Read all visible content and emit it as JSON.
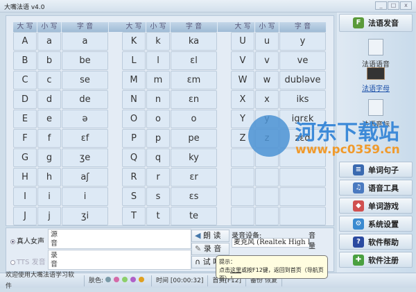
{
  "window": {
    "title": "大嘴法语 v4.0",
    "min": "_",
    "max": "□",
    "close": "x"
  },
  "table": {
    "headers": [
      "大 写",
      "小 写",
      "字 音"
    ],
    "groups": [
      [
        [
          "A",
          "a",
          "a"
        ],
        [
          "B",
          "b",
          "be"
        ],
        [
          "C",
          "c",
          "se"
        ],
        [
          "D",
          "d",
          "de"
        ],
        [
          "E",
          "e",
          "ə"
        ],
        [
          "F",
          "f",
          "ɛf"
        ],
        [
          "G",
          "g",
          "ʒe"
        ],
        [
          "H",
          "h",
          "aʃ"
        ],
        [
          "I",
          "i",
          "i"
        ],
        [
          "J",
          "j",
          "ʒi"
        ]
      ],
      [
        [
          "K",
          "k",
          "ka"
        ],
        [
          "L",
          "l",
          "ɛl"
        ],
        [
          "M",
          "m",
          "ɛm"
        ],
        [
          "N",
          "n",
          "ɛn"
        ],
        [
          "O",
          "o",
          "o"
        ],
        [
          "P",
          "p",
          "pe"
        ],
        [
          "Q",
          "q",
          "ky"
        ],
        [
          "R",
          "r",
          "ɛr"
        ],
        [
          "S",
          "s",
          "ɛs"
        ],
        [
          "T",
          "t",
          "te"
        ]
      ],
      [
        [
          "U",
          "u",
          "y"
        ],
        [
          "V",
          "v",
          "ve"
        ],
        [
          "W",
          "w",
          "dubləve"
        ],
        [
          "X",
          "x",
          "iks"
        ],
        [
          "Y",
          "y",
          "igrɛk"
        ],
        [
          "Z",
          "z",
          "zɛd"
        ],
        [
          "",
          "",
          ""
        ],
        [
          "",
          "",
          ""
        ],
        [
          "",
          "",
          ""
        ],
        [
          "",
          "",
          ""
        ]
      ]
    ]
  },
  "bottom": {
    "voice_real": "真人女声",
    "voice_tts": "TTS 发音",
    "source_label": "源音",
    "record_label": "录音",
    "read_btn": "朗 读",
    "record_btn": "录 音",
    "listen_btn": "试 听",
    "device_label": "录音设备:",
    "device_value": "麦克风 (Realtek High I",
    "volume_label": "音 量"
  },
  "tooltip": {
    "title": "提示：",
    "pre": "点击",
    "link": "这里",
    "post": "或按F12键，返回到首页（导航页面）！"
  },
  "status": {
    "welcome": "欢迎使用大嘴法语学习软件",
    "skin_label": "肤色:",
    "skins": [
      "#7a9aa8",
      "#d46aa8",
      "#8ccf6a",
      "#b060c8",
      "#e0a020"
    ],
    "time": "时间 [00:00:32]",
    "home": "首页[F12]",
    "backup": "备份",
    "restore": "恢复"
  },
  "sidebar": {
    "top": "法语发音",
    "nav": [
      "法语语音",
      "法语字母",
      "法语音标"
    ],
    "buttons": [
      "单词句子",
      "语音工具",
      "单词游戏",
      "系统设置",
      "软件帮助",
      "软件注册"
    ]
  },
  "watermark": {
    "name": "河东下载站",
    "url": "www.pc0359.cn"
  }
}
